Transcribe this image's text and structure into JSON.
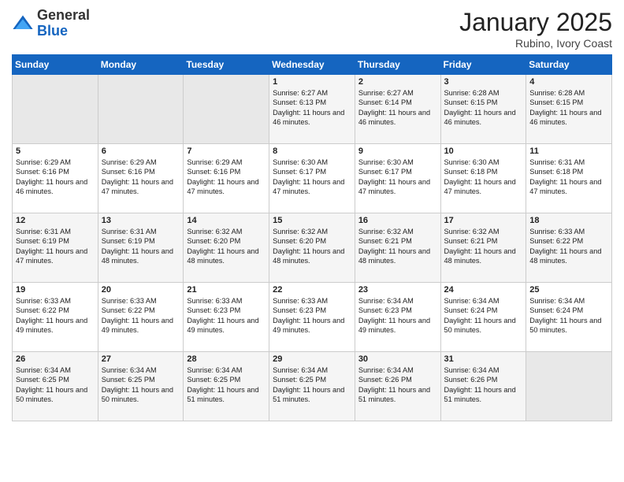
{
  "logo": {
    "general": "General",
    "blue": "Blue"
  },
  "title": "January 2025",
  "subtitle": "Rubino, Ivory Coast",
  "days_of_week": [
    "Sunday",
    "Monday",
    "Tuesday",
    "Wednesday",
    "Thursday",
    "Friday",
    "Saturday"
  ],
  "weeks": [
    [
      {
        "day": "",
        "empty": true
      },
      {
        "day": "",
        "empty": true
      },
      {
        "day": "",
        "empty": true
      },
      {
        "day": "1",
        "sunrise": "Sunrise: 6:27 AM",
        "sunset": "Sunset: 6:13 PM",
        "daylight": "Daylight: 11 hours and 46 minutes."
      },
      {
        "day": "2",
        "sunrise": "Sunrise: 6:27 AM",
        "sunset": "Sunset: 6:14 PM",
        "daylight": "Daylight: 11 hours and 46 minutes."
      },
      {
        "day": "3",
        "sunrise": "Sunrise: 6:28 AM",
        "sunset": "Sunset: 6:15 PM",
        "daylight": "Daylight: 11 hours and 46 minutes."
      },
      {
        "day": "4",
        "sunrise": "Sunrise: 6:28 AM",
        "sunset": "Sunset: 6:15 PM",
        "daylight": "Daylight: 11 hours and 46 minutes."
      }
    ],
    [
      {
        "day": "5",
        "sunrise": "Sunrise: 6:29 AM",
        "sunset": "Sunset: 6:16 PM",
        "daylight": "Daylight: 11 hours and 46 minutes."
      },
      {
        "day": "6",
        "sunrise": "Sunrise: 6:29 AM",
        "sunset": "Sunset: 6:16 PM",
        "daylight": "Daylight: 11 hours and 47 minutes."
      },
      {
        "day": "7",
        "sunrise": "Sunrise: 6:29 AM",
        "sunset": "Sunset: 6:16 PM",
        "daylight": "Daylight: 11 hours and 47 minutes."
      },
      {
        "day": "8",
        "sunrise": "Sunrise: 6:30 AM",
        "sunset": "Sunset: 6:17 PM",
        "daylight": "Daylight: 11 hours and 47 minutes."
      },
      {
        "day": "9",
        "sunrise": "Sunrise: 6:30 AM",
        "sunset": "Sunset: 6:17 PM",
        "daylight": "Daylight: 11 hours and 47 minutes."
      },
      {
        "day": "10",
        "sunrise": "Sunrise: 6:30 AM",
        "sunset": "Sunset: 6:18 PM",
        "daylight": "Daylight: 11 hours and 47 minutes."
      },
      {
        "day": "11",
        "sunrise": "Sunrise: 6:31 AM",
        "sunset": "Sunset: 6:18 PM",
        "daylight": "Daylight: 11 hours and 47 minutes."
      }
    ],
    [
      {
        "day": "12",
        "sunrise": "Sunrise: 6:31 AM",
        "sunset": "Sunset: 6:19 PM",
        "daylight": "Daylight: 11 hours and 47 minutes."
      },
      {
        "day": "13",
        "sunrise": "Sunrise: 6:31 AM",
        "sunset": "Sunset: 6:19 PM",
        "daylight": "Daylight: 11 hours and 48 minutes."
      },
      {
        "day": "14",
        "sunrise": "Sunrise: 6:32 AM",
        "sunset": "Sunset: 6:20 PM",
        "daylight": "Daylight: 11 hours and 48 minutes."
      },
      {
        "day": "15",
        "sunrise": "Sunrise: 6:32 AM",
        "sunset": "Sunset: 6:20 PM",
        "daylight": "Daylight: 11 hours and 48 minutes."
      },
      {
        "day": "16",
        "sunrise": "Sunrise: 6:32 AM",
        "sunset": "Sunset: 6:21 PM",
        "daylight": "Daylight: 11 hours and 48 minutes."
      },
      {
        "day": "17",
        "sunrise": "Sunrise: 6:32 AM",
        "sunset": "Sunset: 6:21 PM",
        "daylight": "Daylight: 11 hours and 48 minutes."
      },
      {
        "day": "18",
        "sunrise": "Sunrise: 6:33 AM",
        "sunset": "Sunset: 6:22 PM",
        "daylight": "Daylight: 11 hours and 48 minutes."
      }
    ],
    [
      {
        "day": "19",
        "sunrise": "Sunrise: 6:33 AM",
        "sunset": "Sunset: 6:22 PM",
        "daylight": "Daylight: 11 hours and 49 minutes."
      },
      {
        "day": "20",
        "sunrise": "Sunrise: 6:33 AM",
        "sunset": "Sunset: 6:22 PM",
        "daylight": "Daylight: 11 hours and 49 minutes."
      },
      {
        "day": "21",
        "sunrise": "Sunrise: 6:33 AM",
        "sunset": "Sunset: 6:23 PM",
        "daylight": "Daylight: 11 hours and 49 minutes."
      },
      {
        "day": "22",
        "sunrise": "Sunrise: 6:33 AM",
        "sunset": "Sunset: 6:23 PM",
        "daylight": "Daylight: 11 hours and 49 minutes."
      },
      {
        "day": "23",
        "sunrise": "Sunrise: 6:34 AM",
        "sunset": "Sunset: 6:23 PM",
        "daylight": "Daylight: 11 hours and 49 minutes."
      },
      {
        "day": "24",
        "sunrise": "Sunrise: 6:34 AM",
        "sunset": "Sunset: 6:24 PM",
        "daylight": "Daylight: 11 hours and 50 minutes."
      },
      {
        "day": "25",
        "sunrise": "Sunrise: 6:34 AM",
        "sunset": "Sunset: 6:24 PM",
        "daylight": "Daylight: 11 hours and 50 minutes."
      }
    ],
    [
      {
        "day": "26",
        "sunrise": "Sunrise: 6:34 AM",
        "sunset": "Sunset: 6:25 PM",
        "daylight": "Daylight: 11 hours and 50 minutes."
      },
      {
        "day": "27",
        "sunrise": "Sunrise: 6:34 AM",
        "sunset": "Sunset: 6:25 PM",
        "daylight": "Daylight: 11 hours and 50 minutes."
      },
      {
        "day": "28",
        "sunrise": "Sunrise: 6:34 AM",
        "sunset": "Sunset: 6:25 PM",
        "daylight": "Daylight: 11 hours and 51 minutes."
      },
      {
        "day": "29",
        "sunrise": "Sunrise: 6:34 AM",
        "sunset": "Sunset: 6:25 PM",
        "daylight": "Daylight: 11 hours and 51 minutes."
      },
      {
        "day": "30",
        "sunrise": "Sunrise: 6:34 AM",
        "sunset": "Sunset: 6:26 PM",
        "daylight": "Daylight: 11 hours and 51 minutes."
      },
      {
        "day": "31",
        "sunrise": "Sunrise: 6:34 AM",
        "sunset": "Sunset: 6:26 PM",
        "daylight": "Daylight: 11 hours and 51 minutes."
      },
      {
        "day": "",
        "empty": true
      }
    ]
  ]
}
